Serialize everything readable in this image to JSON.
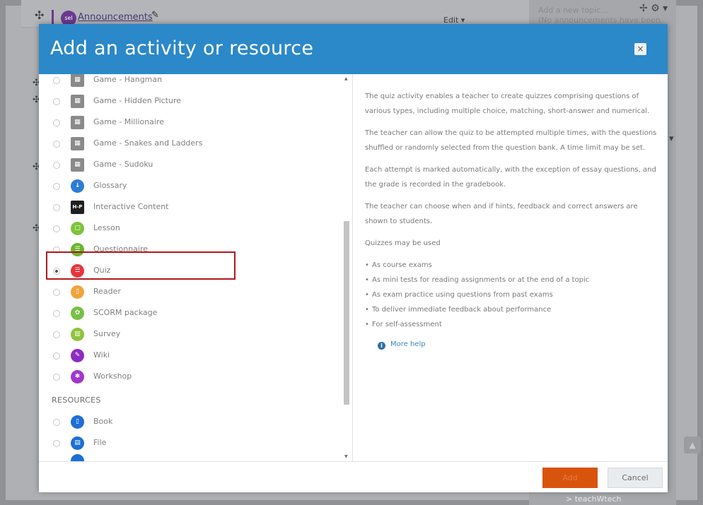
{
  "background": {
    "announcements": "Announcements",
    "forum_badge": "sel",
    "edit": "Edit ▾",
    "topic_line1": "Add a new topic...",
    "topic_line2": "(No announcements have been",
    "bottom_link": "> teachWtech"
  },
  "modal": {
    "title": "Add an activity or resource",
    "close_label": "×",
    "items": [
      {
        "label": "Game - Hangman",
        "icon": "game-icon",
        "color": "#8a8a8a"
      },
      {
        "label": "Game - Hidden Picture",
        "icon": "game-icon",
        "color": "#8a8a8a"
      },
      {
        "label": "Game - Millionaire",
        "icon": "game-icon",
        "color": "#8a8a8a"
      },
      {
        "label": "Game - Snakes and Ladders",
        "icon": "game-icon",
        "color": "#8a8a8a"
      },
      {
        "label": "Game - Sudoku",
        "icon": "game-icon",
        "color": "#8a8a8a"
      },
      {
        "label": "Glossary",
        "icon": "glossary-icon",
        "color": "#2a7dd6"
      },
      {
        "label": "Interactive Content",
        "icon": "h5p-icon",
        "color": "#1f1f1f",
        "glyph": "H-P"
      },
      {
        "label": "Lesson",
        "icon": "lesson-icon",
        "color": "#7cc43a"
      },
      {
        "label": "Questionnaire",
        "icon": "questionnaire-icon",
        "color": "#6bb52d"
      },
      {
        "label": "Quiz",
        "icon": "quiz-icon",
        "color": "#e8333a"
      },
      {
        "label": "Reader",
        "icon": "reader-icon",
        "color": "#f0a43a"
      },
      {
        "label": "SCORM package",
        "icon": "scorm-icon",
        "color": "#76c043"
      },
      {
        "label": "Survey",
        "icon": "survey-icon",
        "color": "#8fc33a"
      },
      {
        "label": "Wiki",
        "icon": "wiki-icon",
        "color": "#8e2bc2"
      },
      {
        "label": "Workshop",
        "icon": "workshop-icon",
        "color": "#a237c9"
      }
    ],
    "selected_item": "Quiz",
    "resources_label": "RESOURCES",
    "resources": [
      {
        "label": "Book",
        "icon": "book-icon",
        "color": "#1d6fd6"
      },
      {
        "label": "File",
        "icon": "file-icon",
        "color": "#1d6fd6"
      }
    ],
    "description": {
      "paragraphs": [
        "The quiz activity enables a teacher to create quizzes comprising questions of various types, including multiple choice, matching, short-answer and numerical.",
        "The teacher can allow the quiz to be attempted multiple times, with the questions shuffled or randomly selected from the question bank. A time limit may be set.",
        "Each attempt is marked automatically, with the exception of essay questions, and the grade is recorded in the gradebook.",
        "The teacher can choose when and if hints, feedback and correct answers are shown to students.",
        "Quizzes may be used"
      ],
      "uses": [
        "As course exams",
        "As mini tests for reading assignments or at the end of a topic",
        "As exam practice using questions from past exams",
        "To deliver immediate feedback about performance",
        "For self-assessment"
      ],
      "more_help": "More help"
    },
    "add_label": "Add",
    "cancel_label": "Cancel"
  },
  "colors": {
    "header": "#2b88c9",
    "add_button": "#d8540d",
    "highlight": "#b1191f"
  }
}
